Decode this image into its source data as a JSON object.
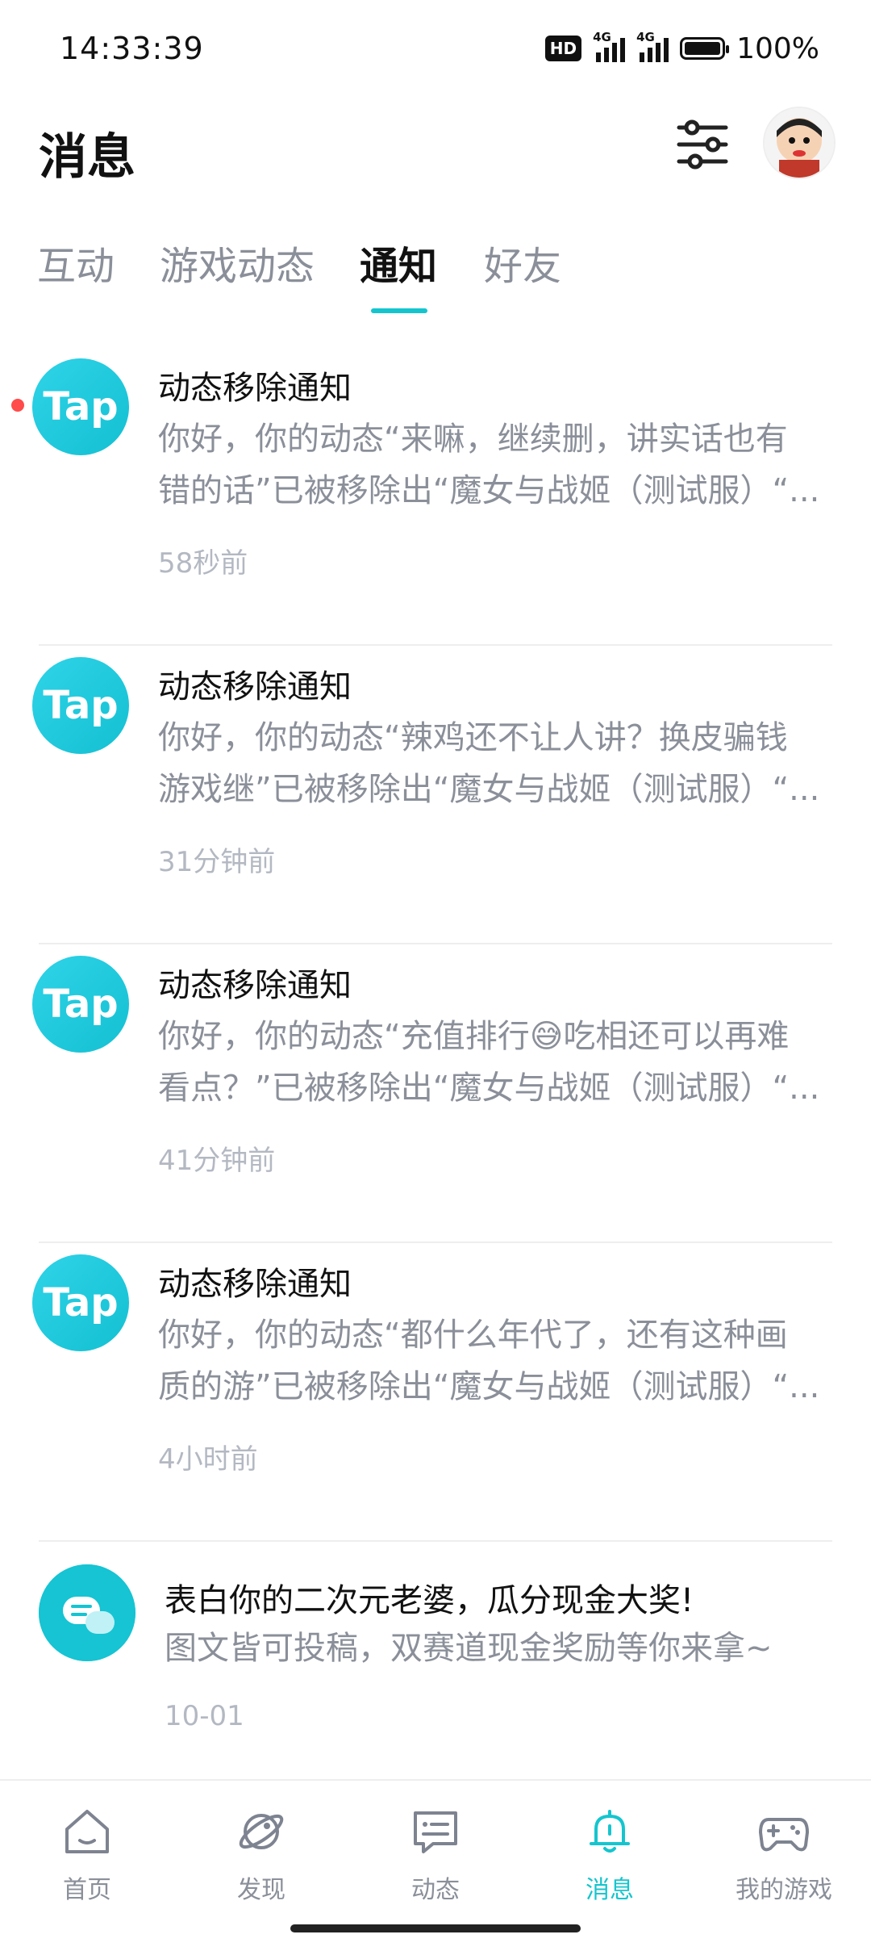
{
  "status_bar": {
    "time": "14:33:39",
    "hd": "HD",
    "net1": "4G",
    "net2": "4G",
    "battery": "100%"
  },
  "header": {
    "title": "消息"
  },
  "tabs": [
    {
      "label": "互动"
    },
    {
      "label": "游戏动态"
    },
    {
      "label": "通知",
      "active": true
    },
    {
      "label": "好友"
    }
  ],
  "notifications": [
    {
      "title": "动态移除通知",
      "line1": "你好，你的动态“来嘛，继续删，讲实话也有",
      "line2": "错的话”已被移除出“魔女与战姬（测试服）“...",
      "time": "58秒前",
      "unread": true,
      "logo": "Tap"
    },
    {
      "title": "动态移除通知",
      "line1": "你好，你的动态“辣鸡还不让人讲？换皮骗钱",
      "line2": "游戏继”已被移除出“魔女与战姬（测试服）“...",
      "time": "31分钟前",
      "logo": "Tap"
    },
    {
      "title": "动态移除通知",
      "line1": "你好，你的动态“充值排行😅吃相还可以再难",
      "line2": "看点？”已被移除出“魔女与战姬（测试服）“...",
      "time": "41分钟前",
      "logo": "Tap"
    },
    {
      "title": "动态移除通知",
      "line1": "你好，你的动态“都什么年代了，还有这种画",
      "line2": "质的游”已被移除出“魔女与战姬（测试服）“...",
      "time": "4小时前",
      "logo": "Tap"
    },
    {
      "title": "表白你的二次元老婆，瓜分现金大奖!",
      "line1": "图文皆可投稿，双赛道现金奖励等你来拿~",
      "time": "10-01"
    }
  ],
  "nav": [
    {
      "label": "首页",
      "icon": "home-icon"
    },
    {
      "label": "发现",
      "icon": "planet-icon"
    },
    {
      "label": "动态",
      "icon": "chat-icon"
    },
    {
      "label": "消息",
      "icon": "bell-icon",
      "active": true
    },
    {
      "label": "我的游戏",
      "icon": "gamepad-icon"
    }
  ],
  "colors": {
    "accent": "#15c5ce",
    "unread": "#ff4b4b",
    "muted": "#8a8f99"
  }
}
